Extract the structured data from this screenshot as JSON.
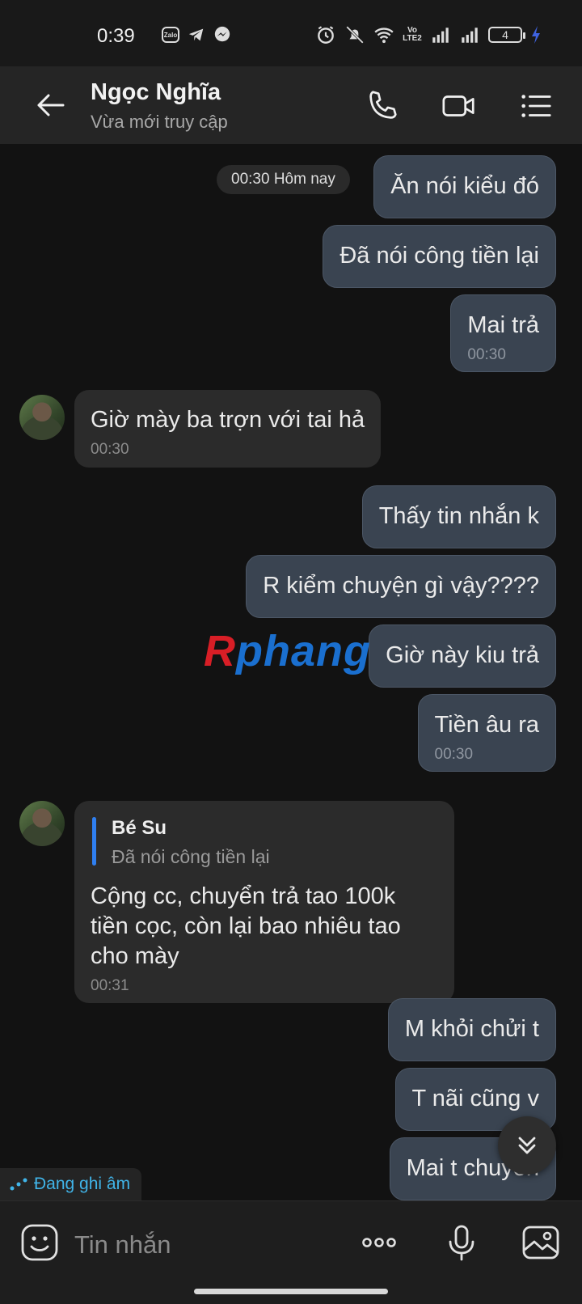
{
  "status_bar": {
    "time": "0:39",
    "zalo_label": "Zalo",
    "volte": "Vo LTE2",
    "battery": "4"
  },
  "header": {
    "title": "Ngọc Nghĩa",
    "subtitle": "Vừa mới truy cập"
  },
  "chat": {
    "time_chip": "00:30 Hôm nay",
    "messages": [
      {
        "text": "Ăn nói kiểu đó",
        "direction": "out"
      },
      {
        "text": "Đã nói công tiền lại",
        "direction": "out"
      },
      {
        "text": "Mai trả",
        "time": "00:30",
        "direction": "out"
      },
      {
        "text": "Giờ mày ba trợn với tai hả",
        "time": "00:30",
        "direction": "in"
      },
      {
        "text": "Thấy tin nhắn k",
        "direction": "out"
      },
      {
        "text": "R kiểm chuyện gì vậy????",
        "direction": "out"
      },
      {
        "text": "Giờ này kiu trả",
        "direction": "out"
      },
      {
        "text": "Tiền âu ra",
        "time": "00:30",
        "direction": "out"
      },
      {
        "text": "M khỏi chửi t",
        "direction": "out"
      },
      {
        "text": "T nãi cũng v",
        "direction": "out"
      },
      {
        "text": "Mai t chuyển",
        "direction": "out"
      }
    ],
    "reply_message": {
      "quoted_name": "Bé Su",
      "quoted_text": "Đã nói công tiền lại",
      "text": "Cộng cc, chuyển trả tao 100k\ntiền cọc, còn lại bao nhiêu tao\ncho mày",
      "time": "00:31"
    },
    "recording_status": "Đang ghi âm",
    "watermark": {
      "first": "R",
      "rest": "phang"
    }
  },
  "input": {
    "placeholder": "Tin nhắn"
  },
  "colors": {
    "accent": "#2f7ff0",
    "outgoing_bubble": "#3a4451",
    "incoming_bubble": "#2b2b2b",
    "recording": "#40b4e8"
  }
}
